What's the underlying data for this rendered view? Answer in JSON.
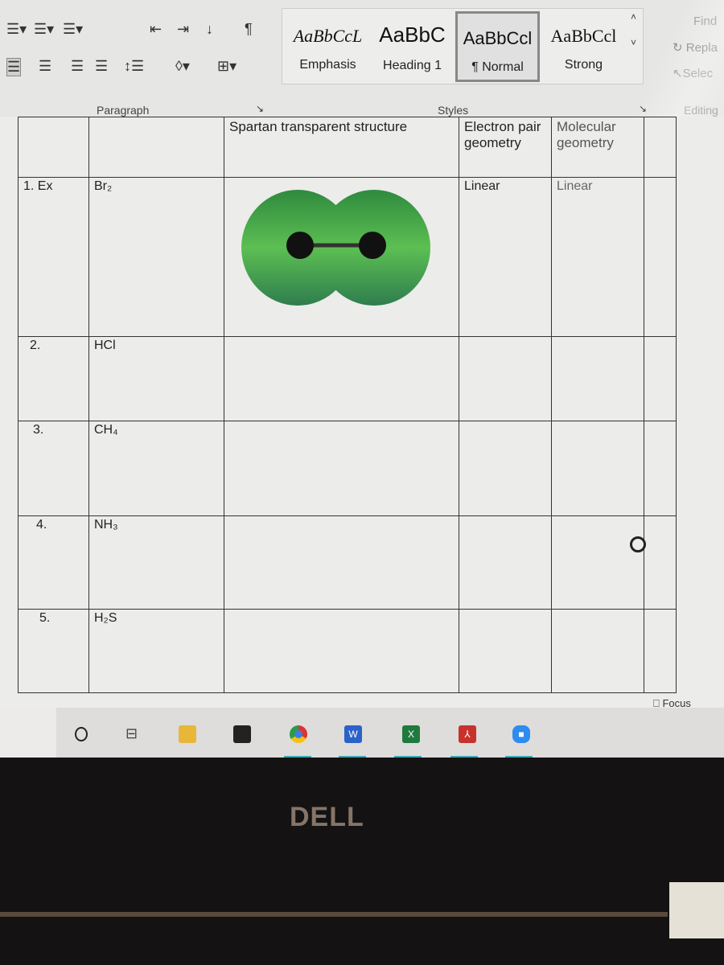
{
  "ribbon": {
    "styles": [
      {
        "sample": "AaBbCcL",
        "label": "Emphasis"
      },
      {
        "sample": "AaBbC",
        "label": "Heading 1"
      },
      {
        "sample": "AaBbCcl",
        "label": "¶ Normal",
        "selected": true
      },
      {
        "sample": "AaBbCcl",
        "label": "Strong"
      }
    ],
    "groups": {
      "paragraph": "Paragraph",
      "styles": "Styles",
      "editing": "Editing"
    },
    "editing": {
      "find": "Find",
      "replace": "Repla",
      "select": "Selec"
    },
    "icons": [
      "bullets-icon",
      "numbering-icon",
      "multilevel-list-icon",
      "decrease-indent-icon",
      "increase-indent-icon",
      "sort-icon",
      "pilcrow-icon",
      "align-left-icon",
      "center-icon",
      "align-right-icon",
      "justify-icon",
      "line-spacing-icon",
      "shading-icon",
      "borders-icon"
    ]
  },
  "table": {
    "header": [
      "",
      "",
      "Spartan transparent structure",
      "Electron pair geometry",
      "Molecular geometry",
      ""
    ],
    "rows": [
      {
        "num": "1. Ex",
        "formula": "Br₂",
        "epg": "Linear",
        "mg": "Linear"
      },
      {
        "num": "2.",
        "formula": "HCl",
        "epg": "",
        "mg": ""
      },
      {
        "num": "3.",
        "formula": "CH₄",
        "epg": "",
        "mg": ""
      },
      {
        "num": "4.",
        "formula": "NH₃",
        "epg": "",
        "mg": ""
      },
      {
        "num": "5.",
        "formula": "H₂S",
        "epg": "",
        "mg": ""
      }
    ]
  },
  "statusbar": {
    "focus": "Focus"
  },
  "taskbar": {
    "apps": [
      "search",
      "task-view",
      "file-explorer",
      "store",
      "chrome",
      "word",
      "excel",
      "acrobat",
      "zoom"
    ],
    "word": "W",
    "excel": "X"
  },
  "bezel": {
    "brand": "DELL"
  },
  "colors": {
    "molecule": "#3f9a4a",
    "accent": "#3fa7b7"
  }
}
